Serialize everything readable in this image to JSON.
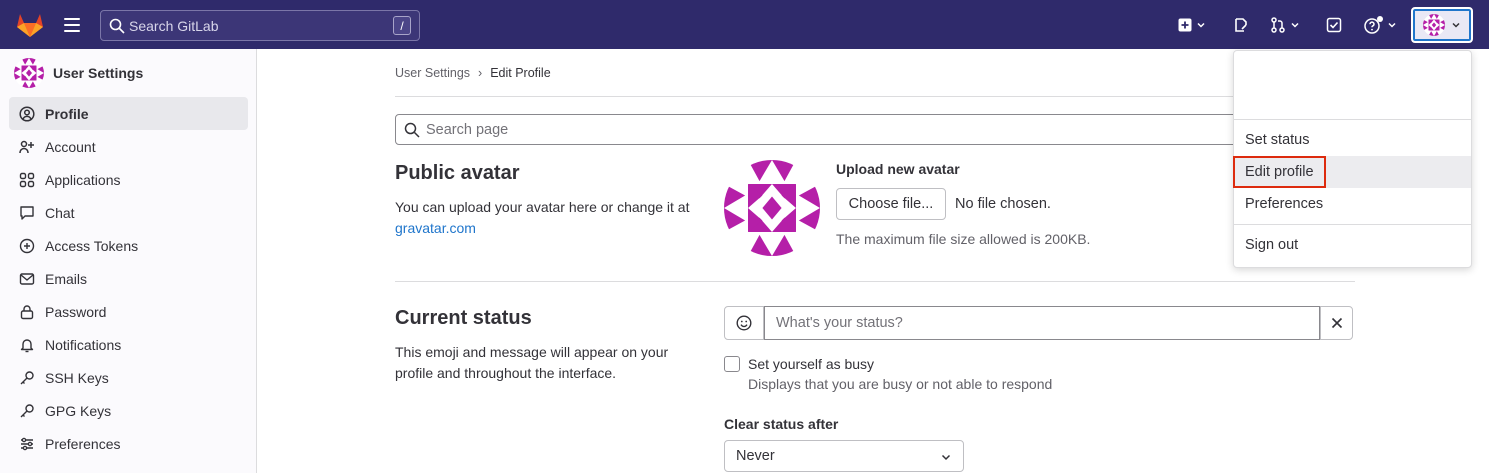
{
  "topbar": {
    "search_placeholder": "Search GitLab",
    "search_shortcut": "/"
  },
  "sidebar": {
    "title": "User Settings",
    "items": [
      {
        "label": "Profile",
        "icon": "profile-icon",
        "active": true
      },
      {
        "label": "Account",
        "icon": "account-icon"
      },
      {
        "label": "Applications",
        "icon": "applications-icon"
      },
      {
        "label": "Chat",
        "icon": "chat-icon"
      },
      {
        "label": "Access Tokens",
        "icon": "token-icon"
      },
      {
        "label": "Emails",
        "icon": "mail-icon"
      },
      {
        "label": "Password",
        "icon": "lock-icon"
      },
      {
        "label": "Notifications",
        "icon": "bell-icon"
      },
      {
        "label": "SSH Keys",
        "icon": "key-icon"
      },
      {
        "label": "GPG Keys",
        "icon": "key-icon"
      },
      {
        "label": "Preferences",
        "icon": "preferences-icon"
      }
    ]
  },
  "breadcrumb": {
    "parent": "User Settings",
    "separator": "›",
    "current": "Edit Profile"
  },
  "search_page": {
    "placeholder": "Search page"
  },
  "public_avatar": {
    "title": "Public avatar",
    "desc_prefix": "You can upload your avatar here or change it at ",
    "desc_link": "gravatar.com",
    "upload_label": "Upload new avatar",
    "choose_button": "Choose file...",
    "no_file": "No file chosen.",
    "max_size": "The maximum file size allowed is 200KB."
  },
  "current_status": {
    "title": "Current status",
    "desc": "This emoji and message will appear on your profile and throughout the interface.",
    "status_placeholder": "What's your status?",
    "busy_label": "Set yourself as busy",
    "busy_help": "Displays that you are busy or not able to respond",
    "clear_after_label": "Clear status after",
    "clear_after_value": "Never"
  },
  "dropdown": {
    "items": [
      "Set status",
      "Edit profile",
      "Preferences",
      "Sign out"
    ]
  },
  "colors": {
    "topbar": "#2f2a6b",
    "accent_link": "#1f75cb",
    "highlight": "#dd2b0e",
    "avatar": "#b51fa8"
  }
}
